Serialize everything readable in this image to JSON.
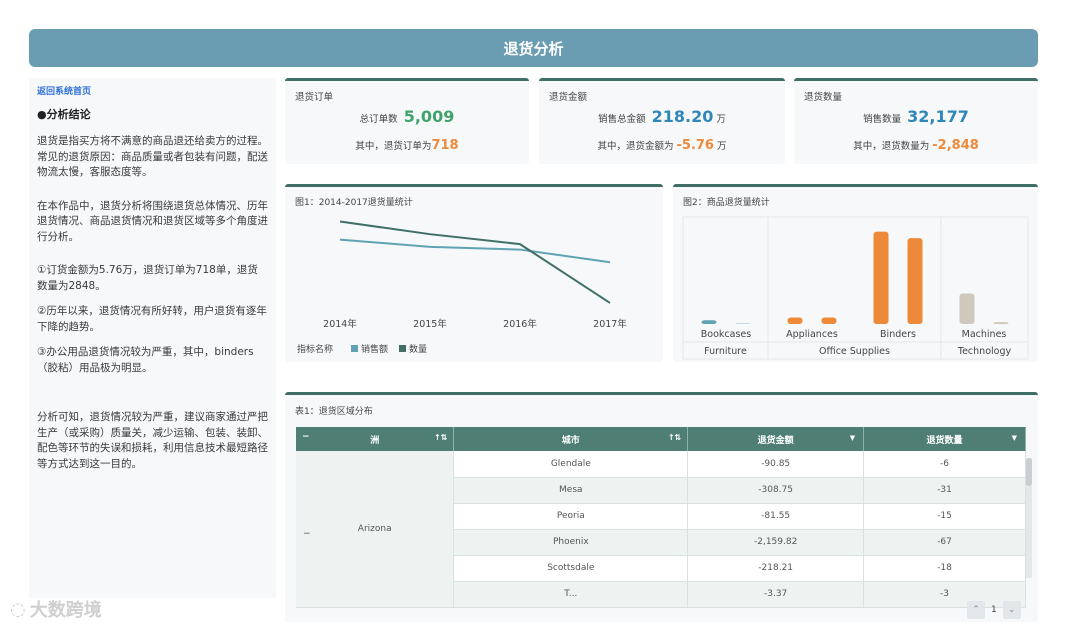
{
  "header": {
    "title": "退货分析"
  },
  "left": {
    "home_link": "返回系统首页",
    "section_title": "●分析结论",
    "para1": "退货是指买方将不满意的商品退还给卖方的过程。常见的退货原因：商品质量或者包装有问题，配送物流太慢，客服态度等。",
    "para2": "在本作品中，退货分析将围绕退货总体情况、历年退货情况、商品退货情况和退货区域等多个角度进行分析。",
    "para3": "①订货金额为5.76万，退货订单为718单，退货数量为2848。",
    "para4": "②历年以来，退货情况有所好转，用户退货有逐年下降的趋势。",
    "para5": "③办公用品退货情况较为严重，其中，binders（胶粘）用品极为明显。",
    "para6": "分析可知，退货情况较为严重，建议商家通过严把生产（或采购）质量关，减少运输、包装、装卸、配色等环节的失误和损耗，利用信息技术最短路径等方式达到这一目的。"
  },
  "kpis": [
    {
      "title": "退货订单",
      "label1": "总订单数",
      "value1": "5,009",
      "label2": "其中，退货订单为",
      "value2": "718",
      "unit": ""
    },
    {
      "title": "退货金额",
      "label1": "销售总金额",
      "value1": "218.20",
      "label2": "其中，退货金额为",
      "value2": "-5.76",
      "unit": "万"
    },
    {
      "title": "退货数量",
      "label1": "销售数量",
      "value1": "32,177",
      "label2": "其中，退货数量为",
      "value2": "-2,848",
      "unit": ""
    }
  ],
  "chart_data": [
    {
      "type": "line",
      "title": "图1：2014-2017退货量统计",
      "categories": [
        "2014年",
        "2015年",
        "2016年",
        "2017年"
      ],
      "legend_label": "指标名称",
      "series": [
        {
          "name": "销售额",
          "color": "#5fa3b3",
          "values": [
            0.8,
            0.72,
            0.69,
            0.55
          ]
        },
        {
          "name": "数量",
          "color": "#3f6f66",
          "values": [
            1.0,
            0.86,
            0.75,
            0.1
          ]
        }
      ],
      "ylim": [
        0,
        1.05
      ]
    },
    {
      "type": "bar",
      "title": "图2：商品退货量统计",
      "groups": [
        {
          "name": "Furniture",
          "categories": [
            "Bookcases"
          ]
        },
        {
          "name": "Office Supplies",
          "categories": [
            "Appliances",
            "Binders"
          ]
        },
        {
          "name": "Technology",
          "categories": [
            "Machines"
          ]
        }
      ],
      "values": [
        {
          "category": "Bookcases",
          "bars": [
            4,
            1
          ],
          "color": "#5fa3b3"
        },
        {
          "category": "Appliances",
          "bars": [
            7,
            7
          ],
          "color": "#ed8a3a"
        },
        {
          "category": "Binders",
          "bars": [
            100,
            93
          ],
          "color": "#ed8a3a"
        },
        {
          "category": "Machines",
          "bars": [
            33,
            2
          ],
          "color": "#cfc8bc"
        }
      ],
      "ylim": [
        0,
        105
      ]
    }
  ],
  "table": {
    "title": "表1：退货区域分布",
    "headers": [
      "洲",
      "城市",
      "退货金额",
      "退货数量"
    ],
    "continent": "Arizona",
    "rows": [
      [
        "Glendale",
        "-90.85",
        "-6"
      ],
      [
        "Mesa",
        "-308.75",
        "-31"
      ],
      [
        "Peoria",
        "-81.55",
        "-15"
      ],
      [
        "Phoenix",
        "-2,159.82",
        "-67"
      ],
      [
        "Scottsdale",
        "-218.21",
        "-18"
      ],
      [
        "T...",
        "-3.37",
        "-3"
      ]
    ]
  },
  "pager": {
    "page": "1"
  },
  "watermark": "大数跨境"
}
